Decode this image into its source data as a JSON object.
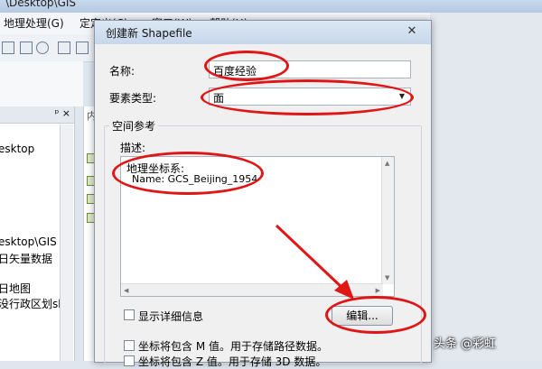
{
  "background": {
    "title": "\\Desktop\\GIS",
    "menu": [
      {
        "label": "地理处理(G)"
      },
      {
        "label": "定定义(C)"
      },
      {
        "label": "窗口(W)"
      },
      {
        "label": "帮助(H)"
      }
    ],
    "panel_pin": "ᵖ ×",
    "tree": [
      {
        "text": "esktop"
      },
      {
        "text": "esktop\\GIS"
      },
      {
        "text": "日矢量数据"
      },
      {
        "text": "日地图"
      },
      {
        "text": "没行政区划sh"
      }
    ],
    "mid_header": "内"
  },
  "dialog": {
    "title": "创建新 Shapefile",
    "close": "✕",
    "name_label": "名称:",
    "name_value": "百度经验",
    "feature_type_label": "要素类型:",
    "feature_type_value": "面",
    "spatial_ref_label": "空间参考",
    "description_label": "描述:",
    "description_line1": "地理坐标系:",
    "description_line2": "Name: GCS_Beijing_1954",
    "show_details_label": "显示详细信息",
    "edit_button": "编辑...",
    "m_value_label": "坐标将包含 M 值。用于存储路径数据。",
    "z_value_label": "坐标将包含 Z 值。用于存储 3D 数据。"
  },
  "watermark": "头条 @彩虹",
  "colors": {
    "annotation": "#e01515",
    "title_bar": "#c7d7eb"
  }
}
